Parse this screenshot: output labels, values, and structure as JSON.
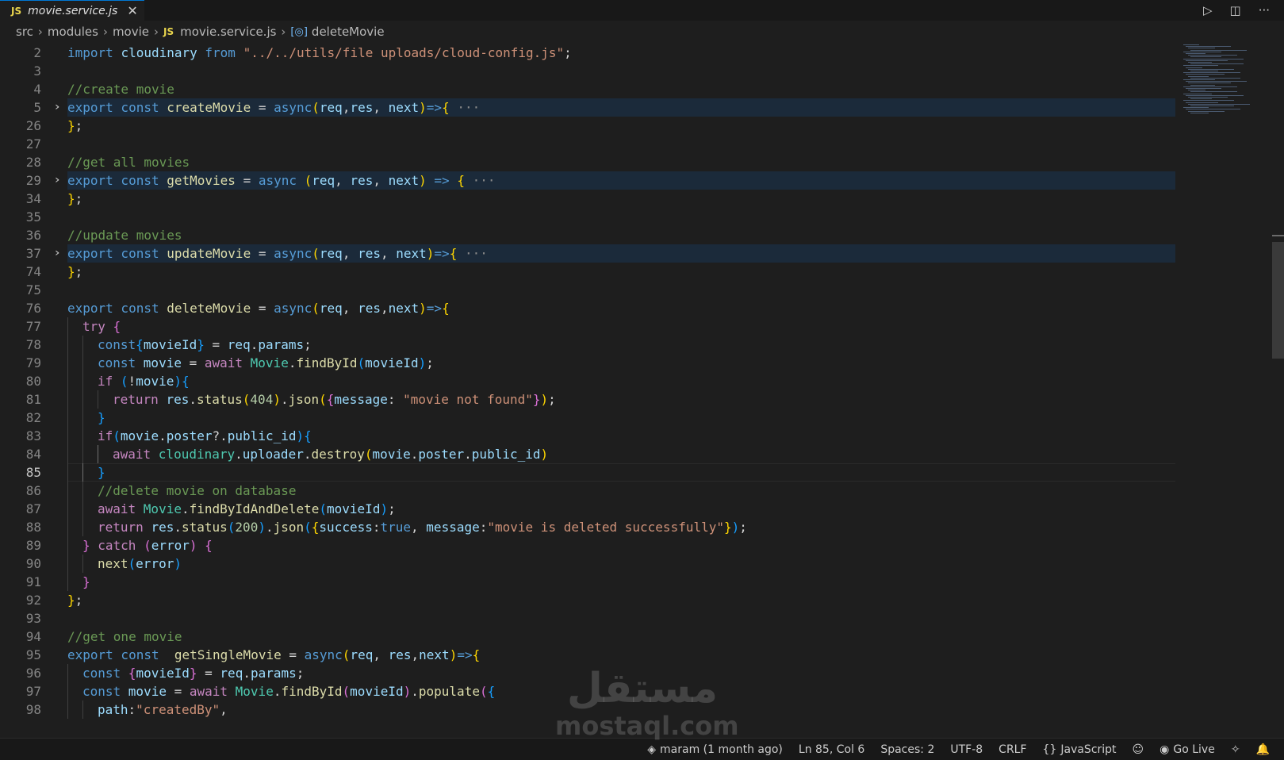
{
  "tab": {
    "badge": "JS",
    "title": "movie.service.js",
    "close": "✕"
  },
  "title_actions": {
    "run": "▷",
    "split": "◫",
    "more": "···"
  },
  "breadcrumb": {
    "items": [
      "src",
      "modules",
      "movie"
    ],
    "file_badge": "JS",
    "file": "movie.service.js",
    "symbol_icon": "[◎]",
    "symbol": "deleteMovie",
    "separator": "›"
  },
  "editor": {
    "lines": [
      {
        "n": "2",
        "indent": 0,
        "tokens": [
          [
            "kw",
            "import "
          ],
          [
            "var",
            "cloudinary "
          ],
          [
            "kw",
            "from "
          ],
          [
            "str",
            "\"../../utils/file uploads/cloud-config.js\""
          ],
          [
            "pun",
            ";"
          ]
        ]
      },
      {
        "n": "3",
        "indent": 0,
        "tokens": []
      },
      {
        "n": "4",
        "indent": 0,
        "tokens": [
          [
            "cmt",
            "//create movie"
          ]
        ]
      },
      {
        "n": "5",
        "indent": 0,
        "fold": true,
        "tokens": [
          [
            "kw",
            "export const "
          ],
          [
            "fn",
            "createMovie "
          ],
          [
            "pun",
            "= "
          ],
          [
            "kw",
            "async"
          ],
          [
            "b1",
            "("
          ],
          [
            "var",
            "req"
          ],
          [
            "pun",
            ","
          ],
          [
            "var",
            "res"
          ],
          [
            "pun",
            ", "
          ],
          [
            "var",
            "next"
          ],
          [
            "b1",
            ")"
          ],
          [
            "kw",
            "=>"
          ],
          [
            "b1",
            "{"
          ],
          [
            "ell",
            " ···"
          ]
        ]
      },
      {
        "n": "26",
        "indent": 0,
        "tokens": [
          [
            "b1",
            "}"
          ],
          [
            "pun",
            ";"
          ]
        ]
      },
      {
        "n": "27",
        "indent": 0,
        "tokens": []
      },
      {
        "n": "28",
        "indent": 0,
        "tokens": [
          [
            "cmt",
            "//get all movies"
          ]
        ]
      },
      {
        "n": "29",
        "indent": 0,
        "fold": true,
        "tokens": [
          [
            "kw",
            "export const "
          ],
          [
            "fn",
            "getMovies "
          ],
          [
            "pun",
            "= "
          ],
          [
            "kw",
            "async "
          ],
          [
            "b1",
            "("
          ],
          [
            "var",
            "req"
          ],
          [
            "pun",
            ", "
          ],
          [
            "var",
            "res"
          ],
          [
            "pun",
            ", "
          ],
          [
            "var",
            "next"
          ],
          [
            "b1",
            ")"
          ],
          [
            "kw",
            " => "
          ],
          [
            "b1",
            "{"
          ],
          [
            "ell",
            " ···"
          ]
        ]
      },
      {
        "n": "34",
        "indent": 0,
        "tokens": [
          [
            "b1",
            "}"
          ],
          [
            "pun",
            ";"
          ]
        ]
      },
      {
        "n": "35",
        "indent": 0,
        "tokens": []
      },
      {
        "n": "36",
        "indent": 0,
        "tokens": [
          [
            "cmt",
            "//update movies"
          ]
        ]
      },
      {
        "n": "37",
        "indent": 0,
        "fold": true,
        "tokens": [
          [
            "kw",
            "export const "
          ],
          [
            "fn",
            "updateMovie "
          ],
          [
            "pun",
            "= "
          ],
          [
            "kw",
            "async"
          ],
          [
            "b1",
            "("
          ],
          [
            "var",
            "req"
          ],
          [
            "pun",
            ", "
          ],
          [
            "var",
            "res"
          ],
          [
            "pun",
            ", "
          ],
          [
            "var",
            "next"
          ],
          [
            "b1",
            ")"
          ],
          [
            "kw",
            "=>"
          ],
          [
            "b1",
            "{"
          ],
          [
            "ell",
            " ···"
          ]
        ]
      },
      {
        "n": "74",
        "indent": 0,
        "tokens": [
          [
            "b1",
            "}"
          ],
          [
            "pun",
            ";"
          ]
        ]
      },
      {
        "n": "75",
        "indent": 0,
        "tokens": []
      },
      {
        "n": "76",
        "indent": 0,
        "tokens": [
          [
            "kw",
            "export const "
          ],
          [
            "fn",
            "deleteMovie "
          ],
          [
            "pun",
            "= "
          ],
          [
            "kw",
            "async"
          ],
          [
            "b1",
            "("
          ],
          [
            "var",
            "req"
          ],
          [
            "pun",
            ", "
          ],
          [
            "var",
            "res"
          ],
          [
            "pun",
            ","
          ],
          [
            "var",
            "next"
          ],
          [
            "b1",
            ")"
          ],
          [
            "kw",
            "=>"
          ],
          [
            "b1",
            "{"
          ]
        ]
      },
      {
        "n": "77",
        "indent": 1,
        "tokens": [
          [
            "ctl",
            "try "
          ],
          [
            "b2",
            "{"
          ]
        ]
      },
      {
        "n": "78",
        "indent": 2,
        "tokens": [
          [
            "kw",
            "const"
          ],
          [
            "b3",
            "{"
          ],
          [
            "var",
            "movieId"
          ],
          [
            "b3",
            "}"
          ],
          [
            "pun",
            " = "
          ],
          [
            "var",
            "req"
          ],
          [
            "pun",
            "."
          ],
          [
            "var",
            "params"
          ],
          [
            "pun",
            ";"
          ]
        ]
      },
      {
        "n": "79",
        "indent": 2,
        "tokens": [
          [
            "kw",
            "const "
          ],
          [
            "var",
            "movie "
          ],
          [
            "pun",
            "= "
          ],
          [
            "ctl",
            "await "
          ],
          [
            "cls",
            "Movie"
          ],
          [
            "pun",
            "."
          ],
          [
            "fn",
            "findById"
          ],
          [
            "b3",
            "("
          ],
          [
            "var",
            "movieId"
          ],
          [
            "b3",
            ")"
          ],
          [
            "pun",
            ";"
          ]
        ]
      },
      {
        "n": "80",
        "indent": 2,
        "tokens": [
          [
            "ctl",
            "if "
          ],
          [
            "b3",
            "("
          ],
          [
            "pun",
            "!"
          ],
          [
            "var",
            "movie"
          ],
          [
            "b3",
            ")"
          ],
          [
            "b3",
            "{"
          ]
        ]
      },
      {
        "n": "81",
        "indent": 3,
        "tokens": [
          [
            "ctl",
            "return "
          ],
          [
            "var",
            "res"
          ],
          [
            "pun",
            "."
          ],
          [
            "fn",
            "status"
          ],
          [
            "b1",
            "("
          ],
          [
            "num",
            "404"
          ],
          [
            "b1",
            ")"
          ],
          [
            "pun",
            "."
          ],
          [
            "fn",
            "json"
          ],
          [
            "b1",
            "("
          ],
          [
            "b2",
            "{"
          ],
          [
            "var",
            "message"
          ],
          [
            "pun",
            ": "
          ],
          [
            "str",
            "\"movie not found\""
          ],
          [
            "b2",
            "}"
          ],
          [
            "b1",
            ")"
          ],
          [
            "pun",
            ";"
          ]
        ]
      },
      {
        "n": "82",
        "indent": 2,
        "tokens": [
          [
            "b3",
            "}"
          ]
        ]
      },
      {
        "n": "83",
        "indent": 2,
        "tokens": [
          [
            "ctl",
            "if"
          ],
          [
            "b3",
            "("
          ],
          [
            "var",
            "movie"
          ],
          [
            "pun",
            "."
          ],
          [
            "var",
            "poster"
          ],
          [
            "pun",
            "?."
          ],
          [
            "var",
            "public_id"
          ],
          [
            "b3",
            ")"
          ],
          [
            "b3",
            "{"
          ]
        ]
      },
      {
        "n": "84",
        "indent": 3,
        "tokens": [
          [
            "ctl",
            "await "
          ],
          [
            "cls",
            "cloudinary"
          ],
          [
            "pun",
            "."
          ],
          [
            "var",
            "uploader"
          ],
          [
            "pun",
            "."
          ],
          [
            "fn",
            "destroy"
          ],
          [
            "b1",
            "("
          ],
          [
            "var",
            "movie"
          ],
          [
            "pun",
            "."
          ],
          [
            "var",
            "poster"
          ],
          [
            "pun",
            "."
          ],
          [
            "var",
            "public_id"
          ],
          [
            "b1",
            ")"
          ]
        ]
      },
      {
        "n": "85",
        "indent": 2,
        "current": true,
        "tokens": [
          [
            "b3",
            "}"
          ]
        ]
      },
      {
        "n": "86",
        "indent": 2,
        "tokens": [
          [
            "cmt",
            "//delete movie on database"
          ]
        ]
      },
      {
        "n": "87",
        "indent": 2,
        "tokens": [
          [
            "ctl",
            "await "
          ],
          [
            "cls",
            "Movie"
          ],
          [
            "pun",
            "."
          ],
          [
            "fn",
            "findByIdAndDelete"
          ],
          [
            "b3",
            "("
          ],
          [
            "var",
            "movieId"
          ],
          [
            "b3",
            ")"
          ],
          [
            "pun",
            ";"
          ]
        ]
      },
      {
        "n": "88",
        "indent": 2,
        "tokens": [
          [
            "ctl",
            "return "
          ],
          [
            "var",
            "res"
          ],
          [
            "pun",
            "."
          ],
          [
            "fn",
            "status"
          ],
          [
            "b3",
            "("
          ],
          [
            "num",
            "200"
          ],
          [
            "b3",
            ")"
          ],
          [
            "pun",
            "."
          ],
          [
            "fn",
            "json"
          ],
          [
            "b3",
            "("
          ],
          [
            "b1",
            "{"
          ],
          [
            "var",
            "success"
          ],
          [
            "pun",
            ":"
          ],
          [
            "kw",
            "true"
          ],
          [
            "pun",
            ", "
          ],
          [
            "var",
            "message"
          ],
          [
            "pun",
            ":"
          ],
          [
            "str",
            "\"movie is deleted successfully\""
          ],
          [
            "b1",
            "}"
          ],
          [
            "b3",
            ")"
          ],
          [
            "pun",
            ";"
          ]
        ]
      },
      {
        "n": "89",
        "indent": 1,
        "tokens": [
          [
            "b2",
            "} "
          ],
          [
            "ctl",
            "catch "
          ],
          [
            "b2",
            "("
          ],
          [
            "var",
            "error"
          ],
          [
            "b2",
            ") "
          ],
          [
            "b2",
            "{"
          ]
        ]
      },
      {
        "n": "90",
        "indent": 2,
        "tokens": [
          [
            "fn",
            "next"
          ],
          [
            "b3",
            "("
          ],
          [
            "var",
            "error"
          ],
          [
            "b3",
            ")"
          ]
        ]
      },
      {
        "n": "91",
        "indent": 1,
        "tokens": [
          [
            "b2",
            "}"
          ]
        ]
      },
      {
        "n": "92",
        "indent": 0,
        "tokens": [
          [
            "b1",
            "}"
          ],
          [
            "pun",
            ";"
          ]
        ]
      },
      {
        "n": "93",
        "indent": 0,
        "tokens": []
      },
      {
        "n": "94",
        "indent": 0,
        "tokens": [
          [
            "cmt",
            "//get one movie"
          ]
        ]
      },
      {
        "n": "95",
        "indent": 0,
        "tokens": [
          [
            "kw",
            "export const  "
          ],
          [
            "fn",
            "getSingleMovie "
          ],
          [
            "pun",
            "= "
          ],
          [
            "kw",
            "async"
          ],
          [
            "b1",
            "("
          ],
          [
            "var",
            "req"
          ],
          [
            "pun",
            ", "
          ],
          [
            "var",
            "res"
          ],
          [
            "pun",
            ","
          ],
          [
            "var",
            "next"
          ],
          [
            "b1",
            ")"
          ],
          [
            "kw",
            "=>"
          ],
          [
            "b1",
            "{"
          ]
        ]
      },
      {
        "n": "96",
        "indent": 1,
        "tokens": [
          [
            "kw",
            "const "
          ],
          [
            "b2",
            "{"
          ],
          [
            "var",
            "movieId"
          ],
          [
            "b2",
            "}"
          ],
          [
            "pun",
            " = "
          ],
          [
            "var",
            "req"
          ],
          [
            "pun",
            "."
          ],
          [
            "var",
            "params"
          ],
          [
            "pun",
            ";"
          ]
        ]
      },
      {
        "n": "97",
        "indent": 1,
        "tokens": [
          [
            "kw",
            "const "
          ],
          [
            "var",
            "movie "
          ],
          [
            "pun",
            "= "
          ],
          [
            "ctl",
            "await "
          ],
          [
            "cls",
            "Movie"
          ],
          [
            "pun",
            "."
          ],
          [
            "fn",
            "findById"
          ],
          [
            "b2",
            "("
          ],
          [
            "var",
            "movieId"
          ],
          [
            "b2",
            ")"
          ],
          [
            "pun",
            "."
          ],
          [
            "fn",
            "populate"
          ],
          [
            "b2",
            "("
          ],
          [
            "b3",
            "{"
          ]
        ]
      },
      {
        "n": "98",
        "indent": 2,
        "tokens": [
          [
            "var",
            "path"
          ],
          [
            "pun",
            ":"
          ],
          [
            "str",
            "\"createdBy\""
          ],
          [
            "pun",
            ","
          ]
        ]
      }
    ]
  },
  "statusbar": {
    "git": "maram (1 month ago)",
    "position": "Ln 85, Col 6",
    "spaces": "Spaces: 2",
    "encoding": "UTF-8",
    "eol": "CRLF",
    "language": "JavaScript",
    "golive": "Go Live",
    "git_icon": "◈",
    "lang_icon": "{}",
    "copilot_icon": "☺",
    "golive_icon": "◉",
    "ports_icon": "✧",
    "bell_icon": "🔔"
  },
  "watermark": {
    "ar": "مستقل",
    "en": "mostaql.com"
  },
  "colors": {
    "background": "#1e1e1e",
    "keyword": "#569cd6",
    "function": "#dcdcaa",
    "string": "#ce9178",
    "comment": "#6a9955",
    "variable": "#9cdcfe"
  }
}
